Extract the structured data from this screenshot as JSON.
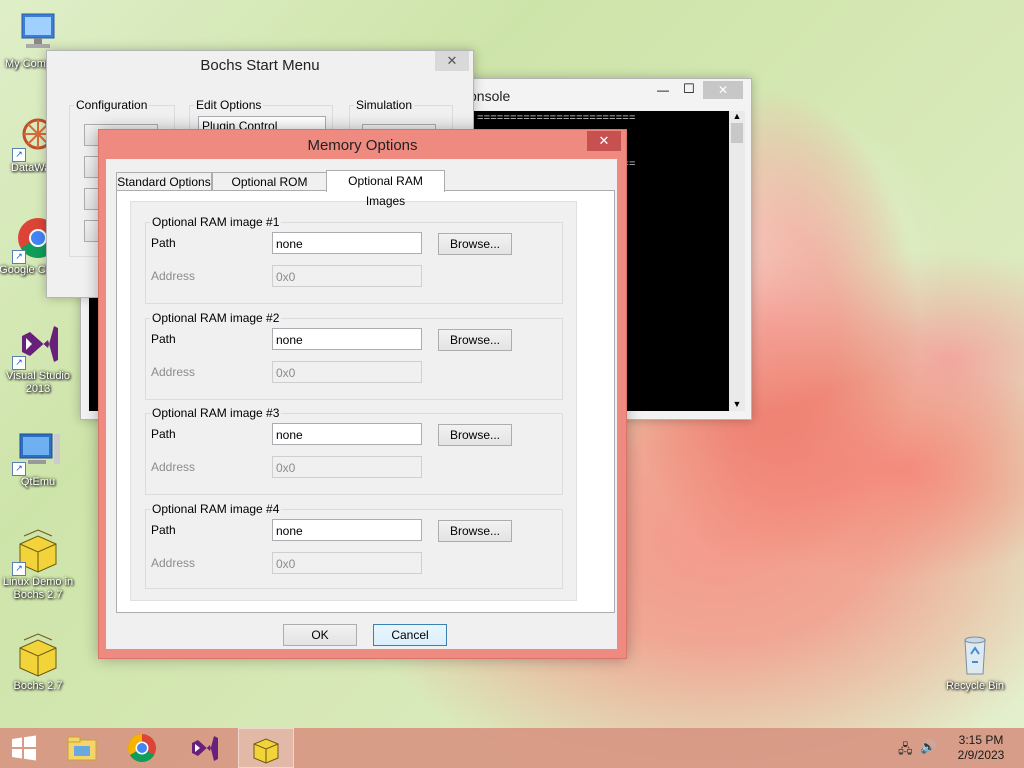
{
  "desktop": {
    "icons": [
      {
        "label": "My Computer"
      },
      {
        "label": "DataWatch"
      },
      {
        "label": "Google Chrome"
      },
      {
        "label": "Visual Studio 2013"
      },
      {
        "label": "QtEmu"
      },
      {
        "label": "Linux Demo in Bochs 2.7"
      },
      {
        "label": "Bochs 2.7"
      },
      {
        "label": "Recycle Bin"
      }
    ]
  },
  "console": {
    "title_fragment": "onsole",
    "lines": [
      "========================",
      "========================"
    ]
  },
  "start_menu": {
    "title": "Bochs Start Menu",
    "groups": {
      "configuration": "Configuration",
      "edit_options": "Edit Options",
      "simulation": "Simulation"
    },
    "edit_list_first_item": "Plugin Control"
  },
  "dialog": {
    "title": "Memory Options",
    "tabs": [
      "Standard Options",
      "Optional ROM Images",
      "Optional RAM Images"
    ],
    "active_tab": "Optional RAM Images",
    "path_label": "Path",
    "address_label": "Address",
    "browse_label": "Browse...",
    "images": [
      {
        "group": "Optional RAM image #1",
        "path": "none",
        "address": "0x0"
      },
      {
        "group": "Optional RAM image #2",
        "path": "none",
        "address": "0x0"
      },
      {
        "group": "Optional RAM image #3",
        "path": "none",
        "address": "0x0"
      },
      {
        "group": "Optional RAM image #4",
        "path": "none",
        "address": "0x0"
      }
    ],
    "ok_label": "OK",
    "cancel_label": "Cancel"
  },
  "taskbar": {
    "time": "3:15 PM",
    "date": "2/9/2023",
    "colors": {
      "taskbar": "#d7968c",
      "dialog_frame": "#ef8a80",
      "close_button": "#c75050"
    }
  }
}
